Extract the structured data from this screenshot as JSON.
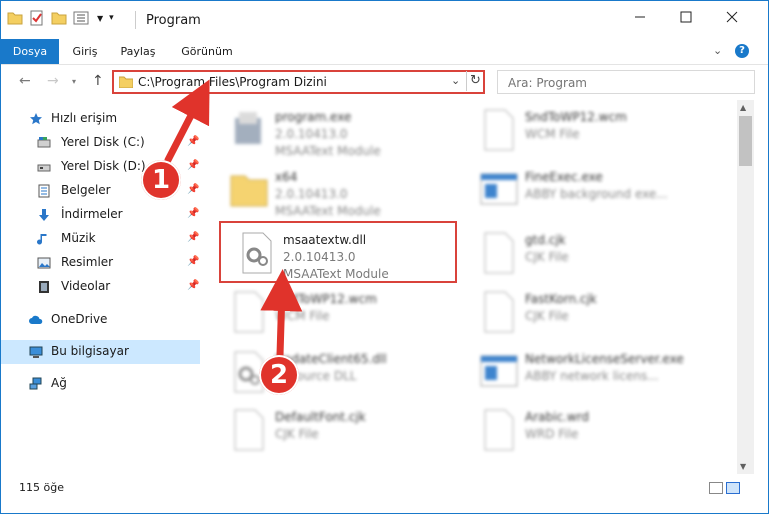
{
  "window": {
    "title": "Program"
  },
  "ribbon": {
    "tabs": [
      "Dosya",
      "Giriş",
      "Paylaş",
      "Görünüm"
    ]
  },
  "nav": {
    "address": "C:\\Program Files\\Program Dizini",
    "search_placeholder": "Ara: Program"
  },
  "sidebar": {
    "quick_access": "Hızlı erişim",
    "items": [
      {
        "label": "Yerel Disk (C:)",
        "icon": "drive-icon"
      },
      {
        "label": "Yerel Disk (D:)",
        "icon": "drive-icon"
      },
      {
        "label": "Belgeler",
        "icon": "documents-icon"
      },
      {
        "label": "İndirmeler",
        "icon": "download-icon"
      },
      {
        "label": "Müzik",
        "icon": "music-icon"
      },
      {
        "label": "Resimler",
        "icon": "pictures-icon"
      },
      {
        "label": "Videolar",
        "icon": "videos-icon"
      }
    ],
    "onedrive": "OneDrive",
    "this_pc": "Bu bilgisayar",
    "network": "Ağ"
  },
  "files": [
    {
      "name": "program.exe",
      "line2": "2.0.10413.0",
      "line3": "MSAAText Module",
      "kind": "exe"
    },
    {
      "name": "SndToWP12.wcm",
      "line2": "WCM File",
      "line3": "",
      "kind": "doc"
    },
    {
      "name": "x64",
      "line2": "2.0.10413.0",
      "line3": "MSAAText Module",
      "kind": "folder"
    },
    {
      "name": "FineExec.exe",
      "line2": "ABBY background exe...",
      "line3": "",
      "kind": "app"
    },
    {
      "name": "msaatextw.dll",
      "line2": "2.0.10413.0",
      "line3": "MSAAText Module",
      "kind": "dll"
    },
    {
      "name": "gtd.cjk",
      "line2": "CJK File",
      "line3": "",
      "kind": "doc"
    },
    {
      "name": "SndToWP12.wcm",
      "line2": "WCM File",
      "line3": "",
      "kind": "doc"
    },
    {
      "name": "FastKorn.cjk",
      "line2": "CJK File",
      "line3": "",
      "kind": "doc"
    },
    {
      "name": "UpdateClient65.dll",
      "line2": "Resource DLL",
      "line3": "",
      "kind": "dll"
    },
    {
      "name": "NetworkLicenseServer.exe",
      "line2": "ABBY network licens...",
      "line3": "",
      "kind": "app"
    },
    {
      "name": "DefaultFont.cjk",
      "line2": "CJK File",
      "line3": "",
      "kind": "doc"
    },
    {
      "name": "Arabic.wrd",
      "line2": "WRD File",
      "line3": "",
      "kind": "doc"
    }
  ],
  "status": {
    "count": "115 öğe"
  },
  "callouts": [
    "1",
    "2"
  ],
  "colors": {
    "accent": "#1979ca",
    "highlight": "#d9433b",
    "selected": "#cce8ff"
  }
}
